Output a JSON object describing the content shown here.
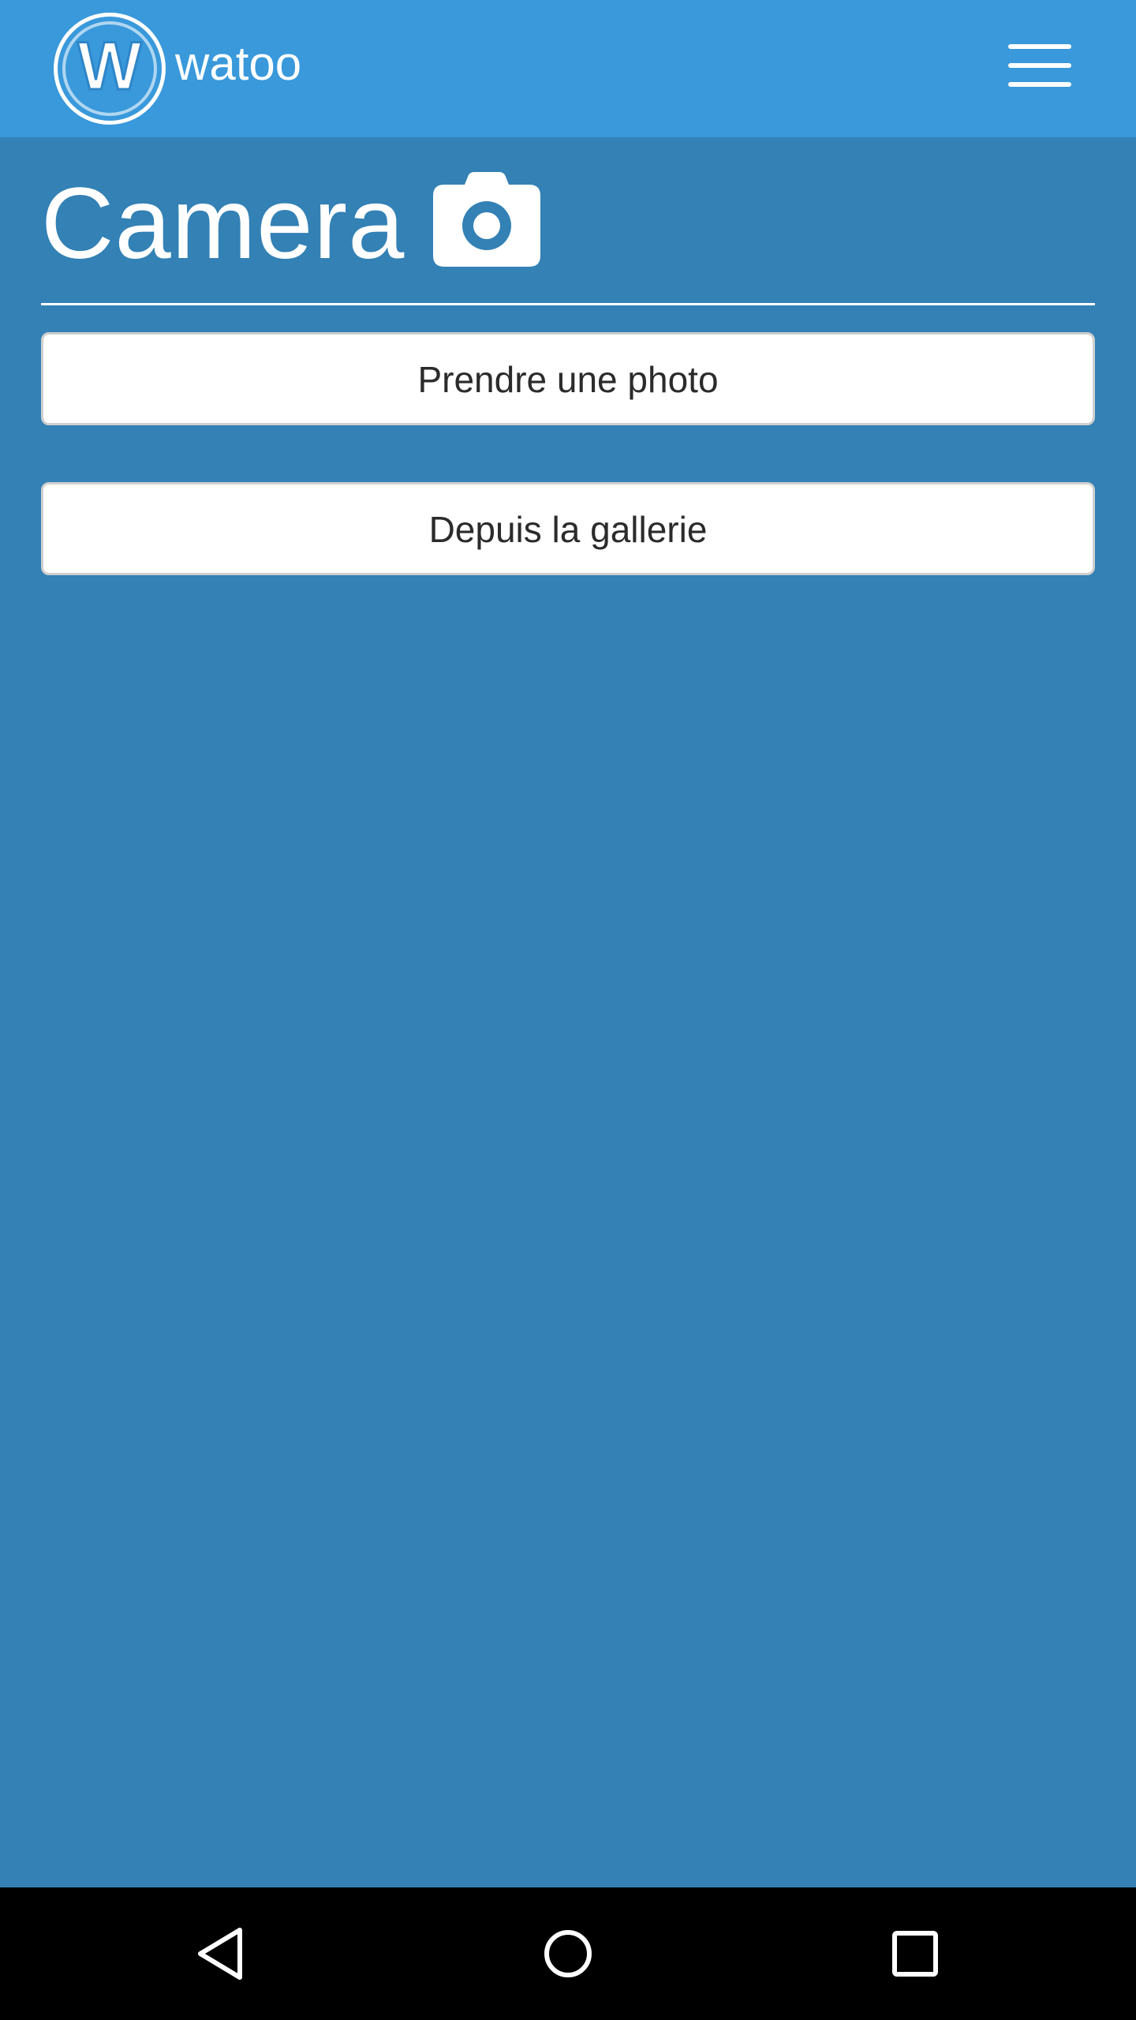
{
  "navbar": {
    "brand_name": "watoo",
    "logo_letter": "W",
    "logo_icon": "watoo-logo",
    "menu_icon": "hamburger-menu-icon"
  },
  "page": {
    "title": "Camera",
    "title_icon": "camera-icon"
  },
  "actions": {
    "take_photo_label": "Prendre une photo",
    "gallery_label": "Depuis la gallerie"
  },
  "system_nav": {
    "back_icon": "back-triangle-icon",
    "home_icon": "home-circle-icon",
    "recent_icon": "recent-apps-square-icon"
  },
  "colors": {
    "navbar": "#3999db",
    "background": "#3381b5",
    "button_bg": "#ffffff",
    "button_text": "#2b2b2b",
    "system_bar": "#000000"
  }
}
